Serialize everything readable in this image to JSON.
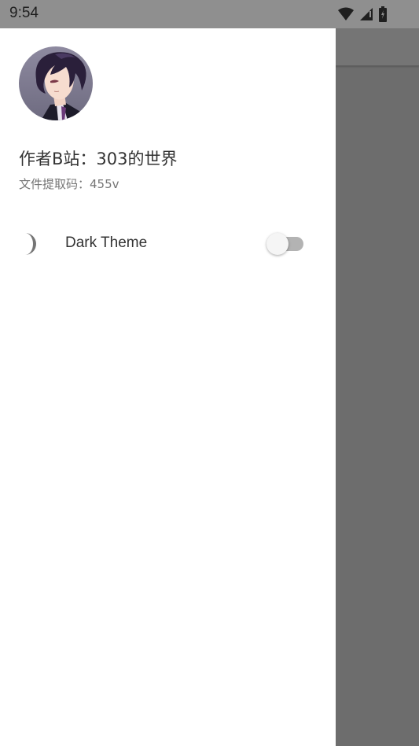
{
  "status_bar": {
    "time": "9:54",
    "icons": [
      "wifi-icon",
      "signal-icon",
      "battery-icon"
    ]
  },
  "drawer": {
    "header": {
      "avatar": "anime-character-avatar",
      "title": "作者B站：303的世界",
      "subtitle": "文件提取码：455v"
    },
    "menu": {
      "items": [
        {
          "label": "Dark Theme",
          "icon": "moon-icon",
          "toggle_on": false
        }
      ]
    }
  },
  "colors": {
    "drawer_bg": "#ffffff",
    "scrim": "#6d6d6d",
    "status_bar": "#8f8f8f",
    "switch_track": "#b3b3b3",
    "switch_thumb": "#f5f5f5"
  }
}
